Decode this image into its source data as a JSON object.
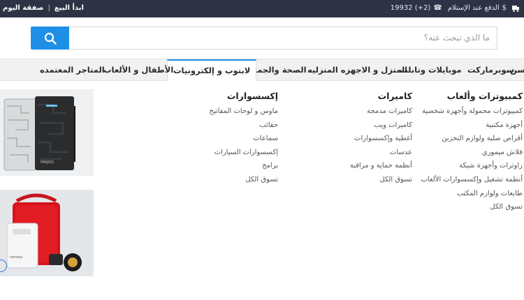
{
  "topbar": {
    "deal_of_day": "صفقة اليوم",
    "start_selling": "ابدأ البيع",
    "cod": "الدفع عند الإستلام",
    "phone": "19932 (+2)",
    "colors": {
      "bg": "#2d3345"
    }
  },
  "search": {
    "placeholder": "ما الذي تبحث عنه؟",
    "button_icon": "search-icon"
  },
  "nav": {
    "tabs": [
      {
        "label": "سن"
      },
      {
        "label": "سوبرماركت"
      },
      {
        "label": "موبايلات وتابلت"
      },
      {
        "label": "المنزل و الاجهزه المنزليه"
      },
      {
        "label": "الصحة والجمال"
      },
      {
        "label": "لابتوب و إلكترونيات",
        "active": true
      },
      {
        "label": "الأطفال و الألعاب"
      },
      {
        "label": "المتاجر المعتمده"
      }
    ]
  },
  "menu": {
    "col1": {
      "title": "كمبيوترات وألعاب",
      "links": [
        "كمبيوترات محمولة وأجهزة شخصية",
        "أجهزة مكتبية",
        "أقراص صلبة ولوازم التخزين",
        "فلاش ميموري",
        "راوترات وأجهزة شبكة",
        "أنظمة تشغيل وإكسسوارات الألعاب",
        "طابعات ولوازم المكتب",
        "تسوق الكل"
      ]
    },
    "col2": {
      "title": "كاميرات",
      "links": [
        "كاميرات مدمجة",
        "كاميرات ويب",
        "أغطية وإكسسوارات",
        "عدسات",
        "أنظمة حماية و مراقبة",
        "تسوق الكل"
      ]
    },
    "col3": {
      "title": "إكسسوارات",
      "links": [
        "ماوس و لوحات المفاتيح",
        "حقائب",
        "سماعات",
        "إكسسوارات السيارات",
        "برامج",
        "تسوق الكل"
      ]
    }
  },
  "promos": {
    "powerbank_brand": "FANJOO",
    "powerbank2_brand": "romoss"
  },
  "accent": "#1f8fe6"
}
